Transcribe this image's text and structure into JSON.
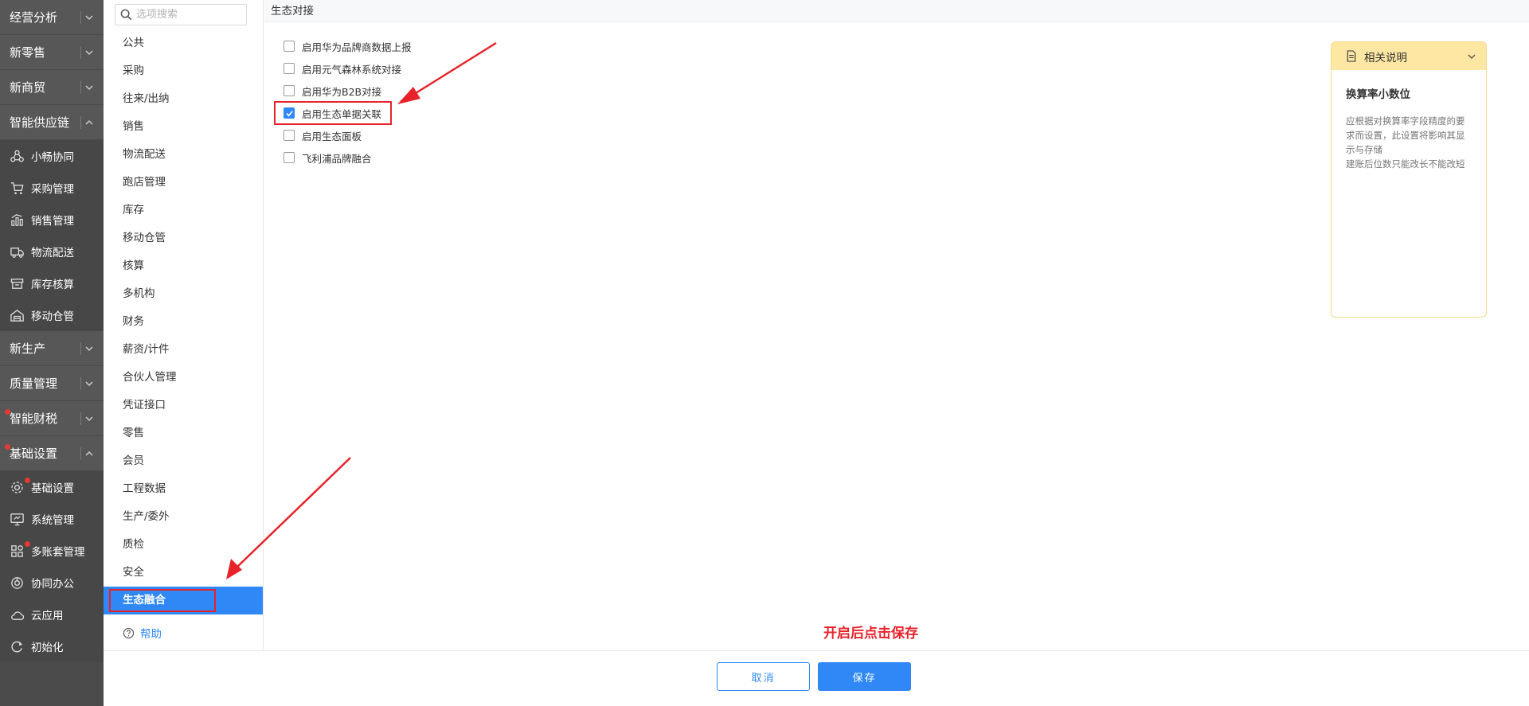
{
  "sidebar": {
    "items": [
      {
        "kind": "group",
        "label": "经营分析",
        "expanded": false,
        "dot": false
      },
      {
        "kind": "group",
        "label": "新零售",
        "expanded": false,
        "dot": false
      },
      {
        "kind": "group",
        "label": "新商贸",
        "expanded": false,
        "dot": false
      },
      {
        "kind": "group",
        "label": "智能供应链",
        "expanded": true,
        "dot": false
      },
      {
        "kind": "sub",
        "label": "小畅协同",
        "icon": "collaboration-icon",
        "dot": false
      },
      {
        "kind": "sub",
        "label": "采购管理",
        "icon": "cart-icon",
        "dot": false
      },
      {
        "kind": "sub",
        "label": "销售管理",
        "icon": "chart-icon",
        "dot": false
      },
      {
        "kind": "sub",
        "label": "物流配送",
        "icon": "truck-icon",
        "dot": false
      },
      {
        "kind": "sub",
        "label": "库存核算",
        "icon": "inventory-icon",
        "dot": false
      },
      {
        "kind": "sub",
        "label": "移动仓管",
        "icon": "warehouse-icon",
        "dot": false
      },
      {
        "kind": "group",
        "label": "新生产",
        "expanded": false,
        "dot": false
      },
      {
        "kind": "group",
        "label": "质量管理",
        "expanded": false,
        "dot": false
      },
      {
        "kind": "group",
        "label": "智能财税",
        "expanded": false,
        "dot": true
      },
      {
        "kind": "group",
        "label": "基础设置",
        "expanded": true,
        "dot": true
      },
      {
        "kind": "sub",
        "label": "基础设置",
        "icon": "settings-icon",
        "dot": true
      },
      {
        "kind": "sub",
        "label": "系统管理",
        "icon": "monitor-icon",
        "dot": false
      },
      {
        "kind": "sub",
        "label": "多账套管理",
        "icon": "apps-icon",
        "dot": true
      },
      {
        "kind": "sub",
        "label": "协同办公",
        "icon": "office-icon",
        "dot": false
      },
      {
        "kind": "sub",
        "label": "云应用",
        "icon": "cloud-icon",
        "dot": false
      },
      {
        "kind": "sub",
        "label": "初始化",
        "icon": "refresh-icon",
        "dot": false
      }
    ]
  },
  "categories": {
    "search_placeholder": "选项搜索",
    "items": [
      "公共",
      "采购",
      "往来/出纳",
      "销售",
      "物流配送",
      "跑店管理",
      "库存",
      "移动仓管",
      "核算",
      "多机构",
      "财务",
      "薪资/计件",
      "合伙人管理",
      "凭证接口",
      "零售",
      "会员",
      "工程数据",
      "生产/委外",
      "质检",
      "安全",
      "生态融合"
    ],
    "active_index": 20,
    "help_label": "帮助"
  },
  "main": {
    "section_title": "生态对接",
    "options": [
      {
        "label": "启用华为品牌商数据上报",
        "checked": false
      },
      {
        "label": "启用元气森林系统对接",
        "checked": false
      },
      {
        "label": "启用华为B2B对接",
        "checked": false
      },
      {
        "label": "启用生态单据关联",
        "checked": true
      },
      {
        "label": "启用生态面板",
        "checked": false
      },
      {
        "label": "飞利浦品牌融合",
        "checked": false
      }
    ]
  },
  "info": {
    "title": "相关说明",
    "subtitle": "换算率小数位",
    "text": [
      "应根据对换算率字段精度的要求而设置，此设置将影响其显示与存储",
      "建账后位数只能改长不能改短"
    ]
  },
  "footer": {
    "cancel_label": "取消",
    "save_label": "保存"
  },
  "annotation": {
    "hint": "开启后点击保存",
    "color": "#e8222a"
  },
  "colors": {
    "accent": "#2f88f5",
    "sidebar_bg": "#4b4b4b",
    "info_header": "#fde7a3"
  }
}
